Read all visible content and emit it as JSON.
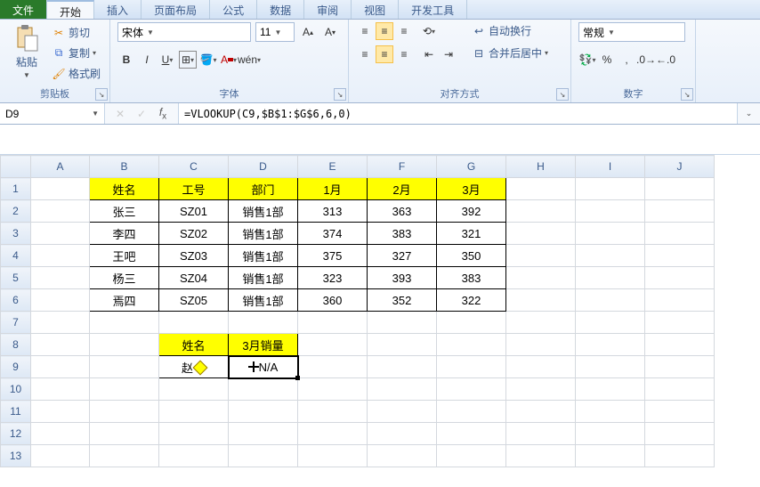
{
  "tabs": {
    "file": "文件",
    "home": "开始",
    "insert": "插入",
    "layout": "页面布局",
    "formulas": "公式",
    "data": "数据",
    "review": "审阅",
    "view": "视图",
    "dev": "开发工具"
  },
  "clipboard": {
    "paste": "粘贴",
    "cut": "剪切",
    "copy": "复制",
    "format": "格式刷",
    "label": "剪贴板"
  },
  "font": {
    "name": "宋体",
    "size": "11",
    "label": "字体"
  },
  "align": {
    "wrap": "自动换行",
    "merge": "合并后居中",
    "label": "对齐方式"
  },
  "number": {
    "format": "常规",
    "label": "数字"
  },
  "namebox": "D9",
  "formula": "=VLOOKUP(C9,$B$1:$G$6,6,0)",
  "cols": [
    "A",
    "B",
    "C",
    "D",
    "E",
    "F",
    "G",
    "H",
    "I",
    "J"
  ],
  "rows": [
    "1",
    "2",
    "3",
    "4",
    "5",
    "6",
    "7",
    "8",
    "9",
    "10",
    "11",
    "12",
    "13"
  ],
  "t1": {
    "header": [
      "姓名",
      "工号",
      "部门",
      "1月",
      "2月",
      "3月"
    ],
    "rows": [
      [
        "张三",
        "SZ01",
        "销售1部",
        "313",
        "363",
        "392"
      ],
      [
        "李四",
        "SZ02",
        "销售1部",
        "374",
        "383",
        "321"
      ],
      [
        "王吧",
        "SZ03",
        "销售1部",
        "375",
        "327",
        "350"
      ],
      [
        "杨三",
        "SZ04",
        "销售1部",
        "323",
        "393",
        "383"
      ],
      [
        "焉四",
        "SZ05",
        "销售1部",
        "360",
        "352",
        "322"
      ]
    ]
  },
  "t2": {
    "header": [
      "姓名",
      "3月销量"
    ],
    "name": "赵",
    "result": "N/A"
  }
}
